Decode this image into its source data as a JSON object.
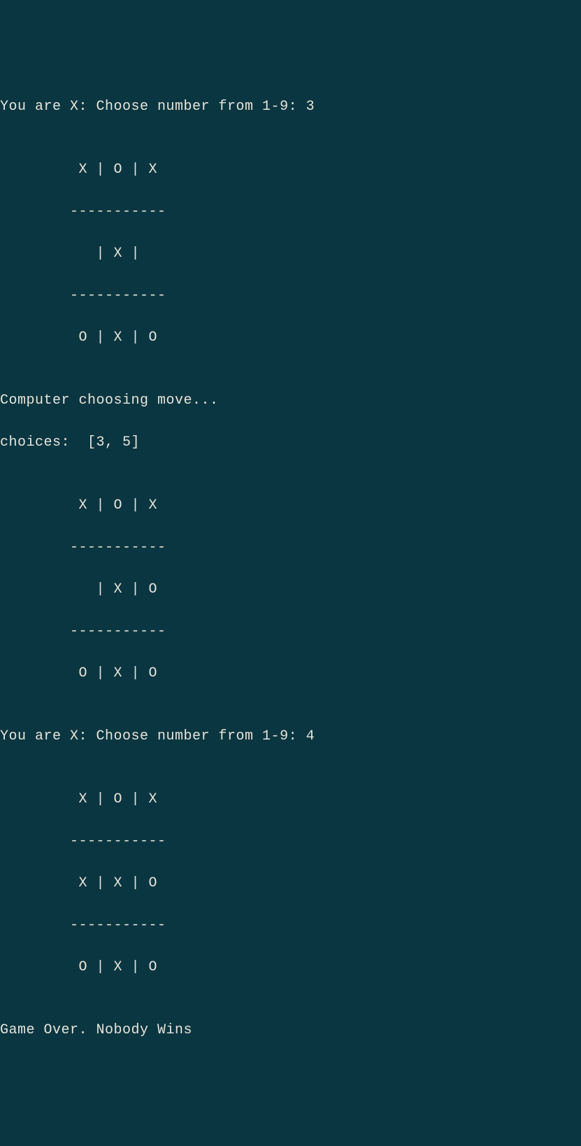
{
  "prompt1": "You are X: Choose number from 1-9: 3",
  "board1": {
    "row1": "         X | O | X",
    "sep1": "        -----------",
    "row2": "           | X |  ",
    "sep2": "        -----------",
    "row3": "         O | X | O"
  },
  "computer_msg": "Computer choosing move...",
  "choices_msg": "choices:  [3, 5]",
  "board2": {
    "row1": "         X | O | X",
    "sep1": "        -----------",
    "row2": "           | X | O",
    "sep2": "        -----------",
    "row3": "         O | X | O"
  },
  "prompt2": "You are X: Choose number from 1-9: 4",
  "board3": {
    "row1": "         X | O | X",
    "sep1": "        -----------",
    "row2": "         X | X | O",
    "sep2": "        -----------",
    "row3": "         O | X | O"
  },
  "game_over": "Game Over. Nobody Wins",
  "blank": ""
}
